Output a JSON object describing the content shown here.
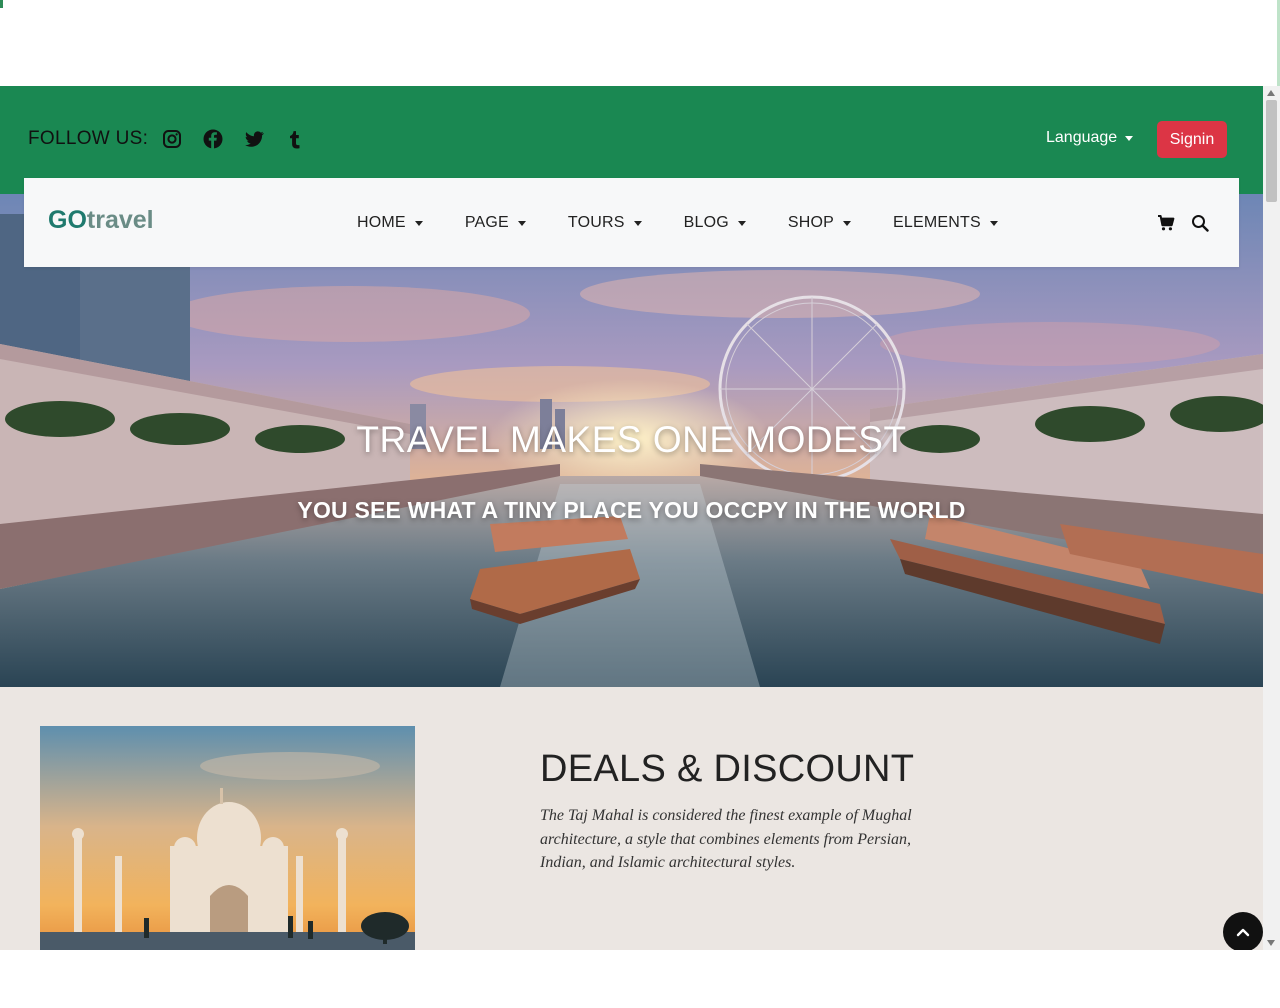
{
  "topbar": {
    "follow_label": "FOLLOW US:",
    "social_icons": [
      "instagram-icon",
      "facebook-icon",
      "twitter-icon",
      "tumblr-icon"
    ],
    "language_label": "Language",
    "signin_label": "Signin"
  },
  "navbar": {
    "logo_go": "GO",
    "logo_travel": "travel",
    "menu": [
      {
        "label": "HOME"
      },
      {
        "label": "PAGE"
      },
      {
        "label": "TOURS"
      },
      {
        "label": "BLOG"
      },
      {
        "label": "SHOP"
      },
      {
        "label": "ELEMENTS"
      }
    ],
    "icons": [
      "cart-icon",
      "search-icon"
    ]
  },
  "hero": {
    "title": "TRAVEL MAKES ONE MODEST",
    "subtitle": "YOU SEE WHAT A TINY PLACE YOU OCCPY IN THE WORLD"
  },
  "deals": {
    "title": "DEALS & DISCOUNT",
    "text": "The Taj Mahal is considered the finest example of Mughal architecture, a style that combines elements from Persian, Indian, and Islamic architectural styles."
  },
  "colors": {
    "topbar_green": "#1a8852",
    "signin_red": "#dc3545",
    "logo_go": "#1f7a6e",
    "logo_travel": "#6a8c86",
    "section_bg": "#ebe6e2"
  }
}
